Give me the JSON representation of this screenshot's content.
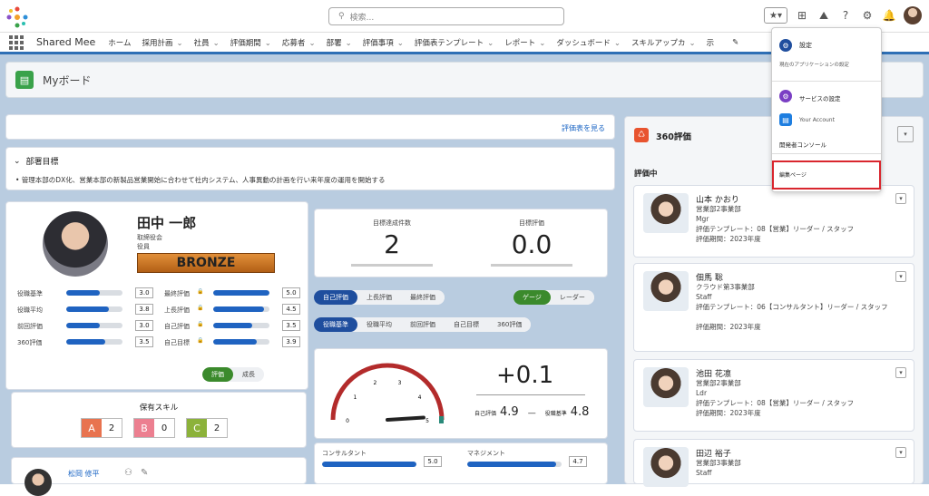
{
  "topbar": {
    "search_placeholder": "検索..."
  },
  "nav": {
    "app_name": "Shared Mee",
    "items": [
      "ホーム",
      "採用計画",
      "社員",
      "評価期間",
      "応募者",
      "部署",
      "評価事項",
      "評価表テンプレート",
      "レポート",
      "ダッシュボード",
      "スキルアップカ"
    ],
    "more": "示"
  },
  "page": {
    "title": "Myボード"
  },
  "eval_link": "評価表を見る",
  "dept": {
    "title": "部署目標",
    "text": "管理本部のDX化、営業本部の新製品営業開始に合わせて社内システム、人事異動の計画を行い来年度の運用を開始する"
  },
  "profile": {
    "name": "田中 一郎",
    "dept": "取締役会",
    "role": "役員",
    "rank": "BRONZE"
  },
  "scores_left": [
    {
      "label": "役職基準",
      "value": "3.0",
      "fill": 0.6
    },
    {
      "label": "役職平均",
      "value": "3.8",
      "fill": 0.76
    },
    {
      "label": "前回評価",
      "value": "3.0",
      "fill": 0.6
    },
    {
      "label": "360評価",
      "value": "3.5",
      "fill": 0.7
    }
  ],
  "scores_right": [
    {
      "label": "最終評価",
      "value": "5.0",
      "fill": 1.0
    },
    {
      "label": "上長評価",
      "value": "4.5",
      "fill": 0.9
    },
    {
      "label": "自己評価",
      "value": "3.5",
      "fill": 0.7
    },
    {
      "label": "自己目標",
      "value": "3.9",
      "fill": 0.78
    }
  ],
  "toggle": {
    "a": "評価",
    "b": "成長"
  },
  "skills": {
    "title": "保有スキル",
    "items": [
      {
        "grade": "A",
        "count": "2",
        "color": "#e8734f"
      },
      {
        "grade": "B",
        "count": "0",
        "color": "#ec7f90"
      },
      {
        "grade": "C",
        "count": "2",
        "color": "#8cb23a"
      }
    ]
  },
  "mini_person": {
    "name": "松岡 修平"
  },
  "stats": {
    "goals_label": "目標達成件数",
    "goals_value": "2",
    "goal_eval_label": "目標評価",
    "goal_eval_value": "0.0"
  },
  "tabs1": [
    "自己評価",
    "上長評価",
    "最終評価"
  ],
  "tabs1_right": [
    "ゲージ",
    "レーダー"
  ],
  "tabs2": [
    "役職基準",
    "役職平均",
    "前回評価",
    "自己目標",
    "360評価"
  ],
  "gauge": {
    "diff": "+0.1",
    "self_label": "自己評価",
    "self_value": "4.9",
    "base_label": "役職基準",
    "base_value": "4.8",
    "ticks": [
      "0",
      "1",
      "2",
      "3",
      "4",
      "5"
    ],
    "value": 4.9,
    "max": 5
  },
  "bottom_bars": [
    {
      "label": "コンサルタント",
      "value": "5.0",
      "fill": 1.0
    },
    {
      "label": "マネジメント",
      "value": "4.7",
      "fill": 0.94
    }
  ],
  "r360": {
    "title": "360評価",
    "section": "評価中"
  },
  "people": [
    {
      "name": "山本 かおり",
      "dept": "営業部2事業部",
      "role": "Mgr",
      "tmpl": "評価テンプレート：08【営業】リーダー / スタッフ",
      "period": "評価期間：2023年度"
    },
    {
      "name": "佃馬 聡",
      "dept": "クラウド第3事業部",
      "role": "Staff",
      "tmpl": "評価テンプレート：06【コンサルタント】リーダー / スタッフ",
      "period": "評価期間：2023年度"
    },
    {
      "name": "池田 花凛",
      "dept": "営業部2事業部",
      "role": "Ldr",
      "tmpl": "評価テンプレート：08【営業】リーダー / スタッフ",
      "period": "評価期間：2023年度"
    },
    {
      "name": "田辺 裕子",
      "dept": "営業部3事業部",
      "role": "Staff",
      "tmpl": "",
      "period": ""
    }
  ],
  "menu": {
    "settings": "設定",
    "settings_sub": "現在のアプリケーションの設定",
    "service": "サービスの設定",
    "account": "Your Account",
    "dev": "開発者コンソール",
    "edit": "編集ページ"
  },
  "colors": {
    "brand_blue": "#1f63c1",
    "highlight_red": "#d9262e",
    "bronze": "#c8741a"
  }
}
